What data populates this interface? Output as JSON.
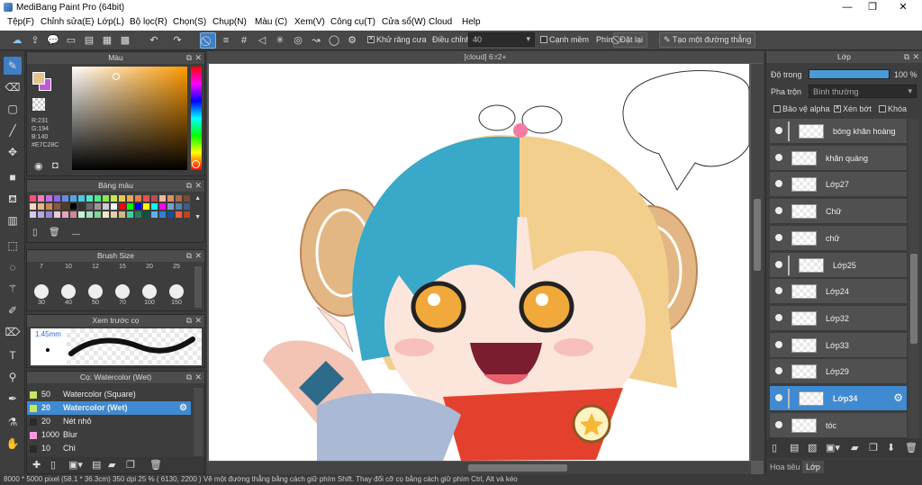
{
  "window": {
    "title": "MediBang Paint Pro (64bit)",
    "minimize": "—",
    "maximize": "❐",
    "close": "✕"
  },
  "menu": [
    "Tệp(F)",
    "Chỉnh sửa(E)",
    "Lớp(L)",
    "Bộ lọc(R)",
    "Chọn(S)",
    "Chụp(N)",
    "Màu (C)",
    "Xem(V)",
    "Công cụ(T)",
    "Cửa sổ(W)",
    "Cloud",
    "Help"
  ],
  "toolbar": {
    "antialias_label": "Khử răng cưa",
    "antialias_checked": true,
    "adjust_label": "Điều chỉnh",
    "adjust_value": "40",
    "smooth_edge_label": "Cạnh mềm",
    "smooth_edge_checked": false,
    "key_label": "Phím",
    "reset_label": "Đặt lại",
    "straight_line_label": "Tạo một đường thẳng"
  },
  "color_panel": {
    "title": "Màu",
    "r": "R:231",
    "g": "G:194",
    "b": "B:140",
    "hex": "#E7C28C",
    "primary_color": "#e7c28c",
    "secondary_color": "#c158d8"
  },
  "palette_panel": {
    "title": "Bảng màu",
    "placeholder": "---",
    "colors": [
      "#ff4f7a",
      "#ff7fb0",
      "#c96ae8",
      "#8a6ae8",
      "#6a8ae8",
      "#4fa8e8",
      "#4fc8e8",
      "#4fe8c8",
      "#4fe88a",
      "#8ae84f",
      "#c8e84f",
      "#e8c84f",
      "#e8a84f",
      "#e87a4f",
      "#e84f4f",
      "#b34f4f",
      "#f2b7a0",
      "#d98e6a",
      "#a86a4a",
      "#7a4a32",
      "#f5d7c0",
      "#e8b48a",
      "#c98a5a",
      "#8a5a3a",
      "#5a3a22",
      "#000000",
      "#333333",
      "#666666",
      "#999999",
      "#cccccc",
      "#ffffff",
      "#ff0000",
      "#00ff00",
      "#0000ff",
      "#ffff00",
      "#00ffff",
      "#ff00ff",
      "#7a9ec9",
      "#5a7ea9",
      "#3a5e89",
      "#d8c8f0",
      "#b8a8e0",
      "#9888d0",
      "#f0c8d8",
      "#e0a8b8",
      "#d08898",
      "#c8f0d8",
      "#a8e0b8",
      "#88d098",
      "#f0e8c8",
      "#e0d0a8",
      "#d0b888",
      "#40d0a0",
      "#208060",
      "#105040",
      "#60b0f0",
      "#3080d0",
      "#1050a0",
      "#f06040",
      "#c04020"
    ]
  },
  "brush_size_panel": {
    "title": "Brush Size",
    "sizes_row1": [
      "7",
      "10",
      "12",
      "15",
      "20",
      "25"
    ],
    "sizes_row2": [
      "30",
      "40",
      "50",
      "70",
      "100",
      "150"
    ]
  },
  "brush_preview_panel": {
    "title": "Xem trước cọ",
    "size_label": "1.45mm"
  },
  "brush_list_panel": {
    "title": "Cọ: Watercolor (Wet)",
    "items": [
      {
        "size": "50",
        "name": "Watercolor (Square)",
        "color": "#c8e860",
        "selected": false
      },
      {
        "size": "20",
        "name": "Watercolor (Wet)",
        "color": "#c8e860",
        "selected": true
      },
      {
        "size": "20",
        "name": "Nét nhỏ",
        "color": "#2a2a2a",
        "selected": false
      },
      {
        "size": "1000",
        "name": "Blur",
        "color": "#ff9ad8",
        "selected": false
      },
      {
        "size": "10",
        "name": "Chì",
        "color": "#2a2a2a",
        "selected": false
      }
    ]
  },
  "canvas": {
    "doc_title": "[cloud] 6:r2+"
  },
  "layer_panel": {
    "title": "Lớp",
    "opacity_label": "Độ trong",
    "opacity_value": "100 %",
    "opacity_fraction": 1.0,
    "blend_label": "Pha trộn",
    "blend_value": "Bình thường",
    "protect_alpha_label": "Bảo vệ alpha",
    "protect_alpha_checked": false,
    "clip_label": "Xén bớt",
    "clip_checked": true,
    "lock_label": "Khóa",
    "lock_checked": false,
    "layers": [
      {
        "name": "bóng khăn hoàng",
        "clipped": true,
        "selected": false
      },
      {
        "name": "khăn quàng",
        "clipped": false,
        "selected": false
      },
      {
        "name": "Lớp27",
        "clipped": false,
        "selected": false
      },
      {
        "name": "Chữ",
        "clipped": false,
        "selected": false
      },
      {
        "name": "chữ",
        "clipped": false,
        "selected": false
      },
      {
        "name": "Lớp25",
        "clipped": true,
        "selected": false
      },
      {
        "name": "Lớp24",
        "clipped": false,
        "selected": false
      },
      {
        "name": "Lớp32",
        "clipped": false,
        "selected": false
      },
      {
        "name": "Lớp33",
        "clipped": false,
        "selected": false
      },
      {
        "name": "Lớp29",
        "clipped": false,
        "selected": false
      },
      {
        "name": "Lớp34",
        "clipped": true,
        "selected": true
      },
      {
        "name": "tóc",
        "clipped": false,
        "selected": false
      }
    ],
    "bottom_tabs": [
      "Hoa tiêu",
      "Lớp"
    ]
  },
  "status": {
    "text": "8000 * 5000 pixel   (58.1 * 36.3cm)   350 dpi   25 %   ( 6130, 2200 )   Vẽ một đường thẳng bằng cách giữ phím Shift. Thay đổi cỡ cọ bằng cách giữ phím Ctrl, Alt và kéo"
  }
}
